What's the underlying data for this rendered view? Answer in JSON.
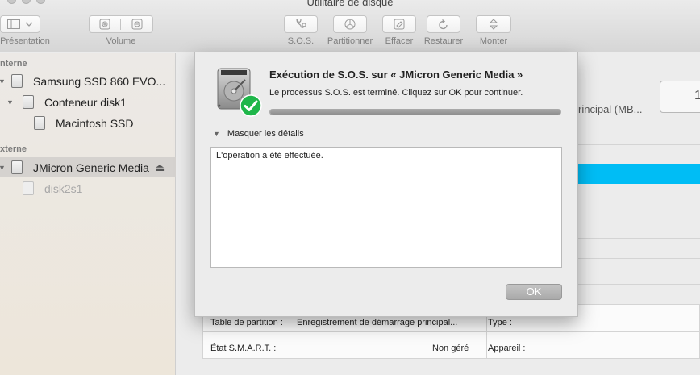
{
  "window": {
    "title": "Utilitaire de disque"
  },
  "toolbar": {
    "presentation_label": "Présentation",
    "volume_label": "Volume",
    "sos_label": "S.O.S.",
    "partition_label": "Partitionner",
    "erase_label": "Effacer",
    "restore_label": "Restaurer",
    "mount_label": "Monter"
  },
  "sidebar": {
    "section_internal": "nterne",
    "section_external": "xterne",
    "items": [
      {
        "label": "Samsung SSD 860 EVO..."
      },
      {
        "label": "Conteneur disk1"
      },
      {
        "label": "Macintosh SSD"
      },
      {
        "label": "JMicron Generic Media"
      },
      {
        "label": "disk2s1"
      }
    ],
    "eject_glyph": "⏏"
  },
  "main": {
    "partial_label": "rincipal (MB...",
    "capacity_digit": "1",
    "usage_color": "#00bdf5",
    "info": {
      "partition_table_label": "Table de partition :",
      "partition_table_value": "Enregistrement de démarrage principal...",
      "smart_label": "État S.M.A.R.T. :",
      "smart_value": "Non géré",
      "type_label": "Type :",
      "device_label": "Appareil :"
    }
  },
  "dialog": {
    "title": "Exécution de S.O.S. sur « JMicron Generic Media »",
    "message": "Le processus S.O.S. est terminé. Cliquez sur OK pour continuer.",
    "progress_percent": 100,
    "details_toggle": "Masquer les détails",
    "details_text": "L'opération a été effectuée.",
    "ok_label": "OK",
    "success_color": "#1fb64a"
  },
  "icons": [
    "sidebar-toggle-icon",
    "chevron-down-icon",
    "add-volume-icon",
    "remove-volume-icon",
    "stethoscope-icon",
    "pie-chart-icon",
    "erase-icon",
    "restore-icon",
    "mount-icon",
    "hard-drive-icon",
    "eject-icon",
    "checkmark-icon",
    "disclosure-triangle-icon"
  ]
}
